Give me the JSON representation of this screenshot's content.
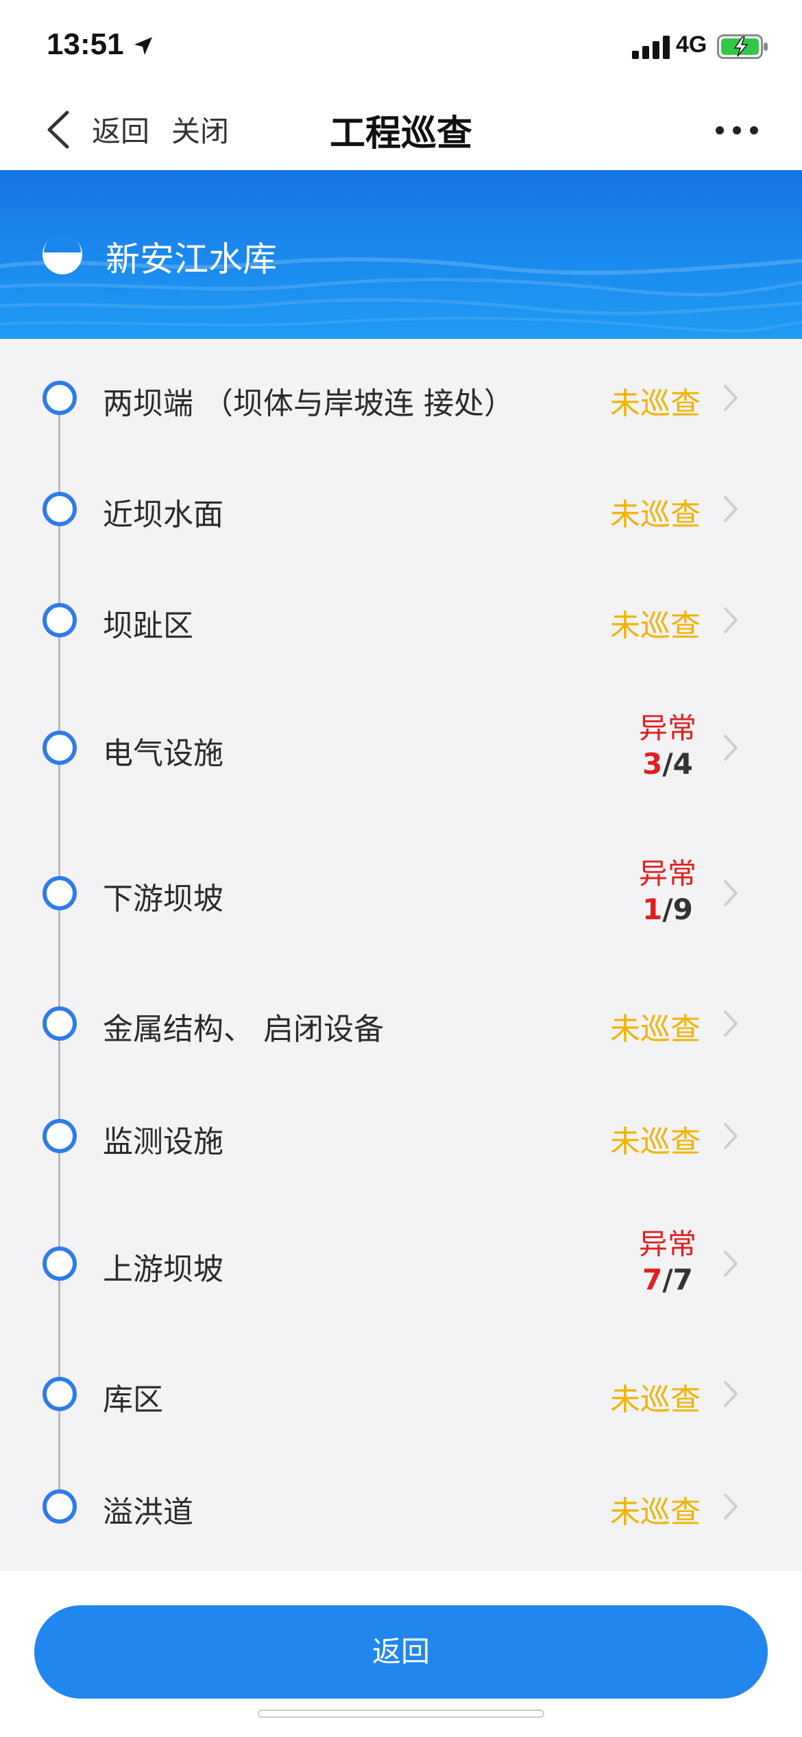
{
  "status_bar": {
    "time": "13:51",
    "network": "4G",
    "icons": [
      "location-arrow-icon",
      "cellular-signal-icon",
      "battery-charging-icon"
    ]
  },
  "nav": {
    "back_label": "返回",
    "close_label": "关闭",
    "title": "工程巡查",
    "more_icon": "more-dots-icon"
  },
  "banner": {
    "reservoir_name": "新安江水库",
    "icon": "half-circle-icon"
  },
  "checkpoints": [
    {
      "label": "两坝端 （坝体与岸坡连 接处）",
      "status": "pending",
      "status_text": "未巡查"
    },
    {
      "label": "近坝水面",
      "status": "pending",
      "status_text": "未巡查"
    },
    {
      "label": "坝趾区",
      "status": "pending",
      "status_text": "未巡查"
    },
    {
      "label": "电气设施",
      "status": "abnormal",
      "status_text": "异常",
      "abnormal": "3",
      "total": "/4"
    },
    {
      "label": "下游坝坡",
      "status": "abnormal",
      "status_text": "异常",
      "abnormal": "1",
      "total": "/9"
    },
    {
      "label": "金属结构、 启闭设备",
      "status": "pending",
      "status_text": "未巡查"
    },
    {
      "label": "监测设施",
      "status": "pending",
      "status_text": "未巡查"
    },
    {
      "label": "上游坝坡",
      "status": "abnormal",
      "status_text": "异常",
      "abnormal": "7",
      "total": "/7"
    },
    {
      "label": "库区",
      "status": "pending",
      "status_text": "未巡查"
    },
    {
      "label": "溢洪道",
      "status": "pending",
      "status_text": "未巡查"
    }
  ],
  "footer": {
    "return_button": "返回"
  },
  "colors": {
    "accent": "#2186ee",
    "pending": "#f0b300",
    "abnormal": "#e02020",
    "node_border": "#2f7bea"
  }
}
